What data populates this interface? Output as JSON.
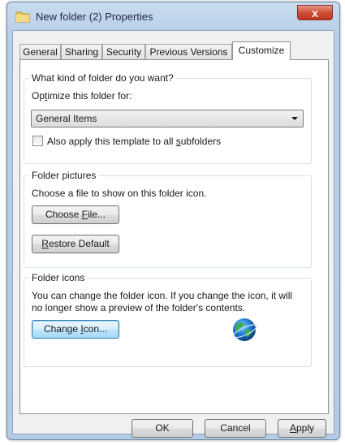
{
  "window": {
    "title": "New folder (2) Properties",
    "close_label": "x"
  },
  "tabs": [
    {
      "label": "General"
    },
    {
      "label": "Sharing"
    },
    {
      "label": "Security"
    },
    {
      "label": "Previous Versions"
    },
    {
      "label": "Customize",
      "active": true
    }
  ],
  "folder_type": {
    "group_title": "What kind of folder do you want?",
    "prompt_pre": "Op",
    "prompt_ul": "t",
    "prompt_post": "imize this folder for:",
    "selected_value": "General Items",
    "checkbox_checked": false,
    "checkbox_pre": "Also apply this template to all ",
    "checkbox_ul": "s",
    "checkbox_post": "ubfolders"
  },
  "folder_pictures": {
    "group_title": "Folder pictures",
    "description": "Choose a file to show on this folder icon.",
    "choose_pre": "Choose ",
    "choose_ul": "F",
    "choose_post": "ile...",
    "restore_ul": "R",
    "restore_post": "estore Default"
  },
  "folder_icons": {
    "group_title": "Folder icons",
    "description_line1": "You can change the folder icon. If you change the icon, it will",
    "description_line2": "no longer show a preview of the folder's contents.",
    "change_pre": "Change ",
    "change_ul": "I",
    "change_post": "con...",
    "icon_name": "globe-icon"
  },
  "footer": {
    "ok_label": "OK",
    "cancel_label": "Cancel",
    "apply_ul": "A",
    "apply_post": "pply"
  },
  "colors": {
    "title_bar": "#b7cfe8",
    "close_button": "#cf4f36",
    "focus_border": "#3c7fb1"
  }
}
